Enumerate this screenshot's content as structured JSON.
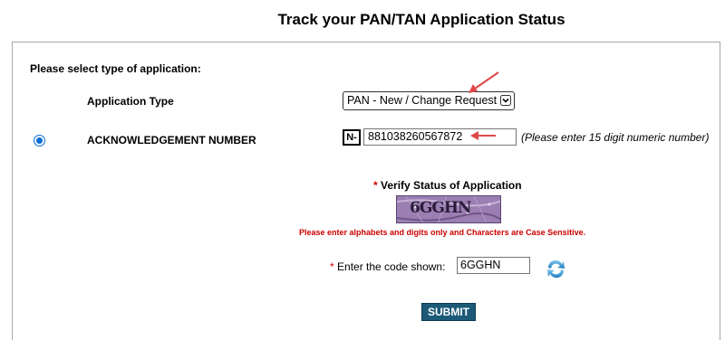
{
  "page": {
    "title": "Track your PAN/TAN Application Status"
  },
  "form": {
    "select_prompt": "Please select type of application:",
    "application_type": {
      "label": "Application Type",
      "selected_value": "PAN - New / Change Request"
    },
    "acknowledgement": {
      "label": "ACKNOWLEDGEMENT NUMBER",
      "prefix": "N-",
      "value": "881038260567872",
      "hint": "(Please enter 15 digit numeric number)",
      "selected": true
    },
    "verify": {
      "required_mark": "*",
      "heading": "Verify Status of Application",
      "captcha_text": "6GGHN",
      "note": "Please enter alphabets and digits only and Characters are Case Sensitive."
    },
    "code": {
      "required_mark": "*",
      "label": "Enter the code shown:",
      "value": "6GGHN"
    },
    "submit_label": "SUBMIT"
  },
  "colors": {
    "submit_bg": "#1c5a78",
    "required": "#cc0000",
    "annotation_arrow": "#e04848",
    "captcha_bg": "#8e6fa6"
  },
  "icons": {
    "dropdown": "chevron-down-icon",
    "refresh": "refresh-icon"
  }
}
